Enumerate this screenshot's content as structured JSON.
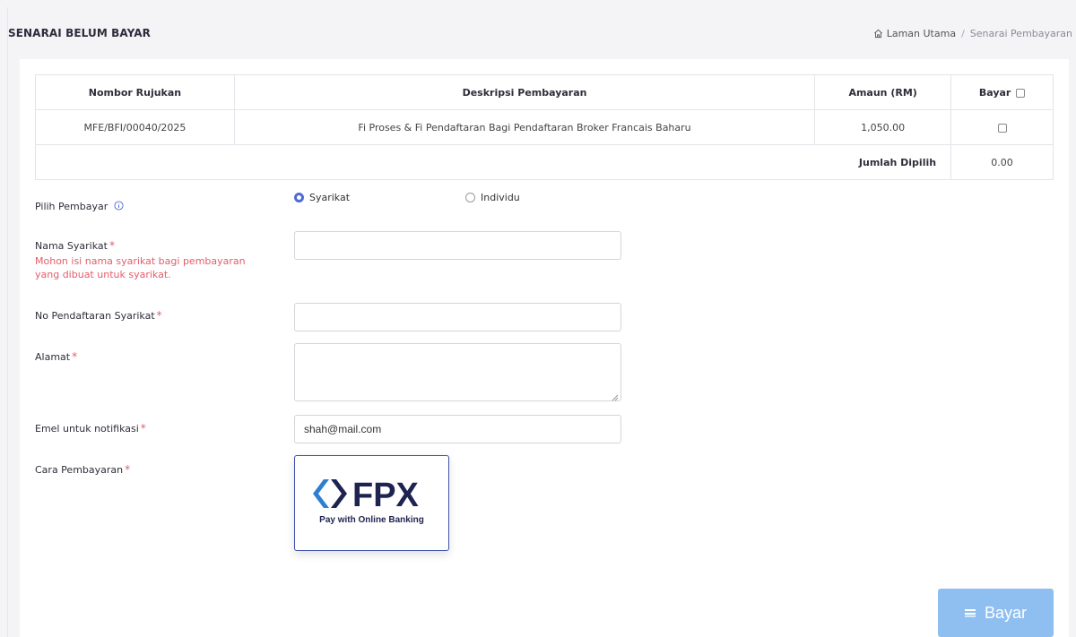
{
  "header": {
    "title": "SENARAI BELUM BAYAR",
    "breadcrumb": {
      "home": "Laman Utama",
      "separator": "/",
      "current": "Senarai Pembayaran"
    }
  },
  "table": {
    "headers": {
      "ref": "Nombor Rujukan",
      "desc": "Deskripsi Pembayaran",
      "amount": "Amaun (RM)",
      "pay": "Bayar"
    },
    "rows": [
      {
        "ref": "MFE/BFI/00040/2025",
        "desc": "Fi Proses & Fi Pendaftaran Bagi Pendaftaran Broker Francais Baharu",
        "amount": "1,050.00"
      }
    ],
    "total_label": "Jumlah Dipilih",
    "total_value": "0.00"
  },
  "form": {
    "payer_label": "Pilih Pembayar",
    "payer_options": {
      "company": "Syarikat",
      "individual": "Individu"
    },
    "payer_selected": "Syarikat",
    "company_name_label": "Nama Syarikat",
    "company_name_warning_1": "Mohon isi nama syarikat bagi pembayaran",
    "company_name_warning_2": "yang dibuat untuk syarikat.",
    "company_name_value": "",
    "reg_no_label": "No Pendaftaran Syarikat",
    "reg_no_value": "",
    "address_label": "Alamat",
    "address_value": "",
    "email_label": "Emel untuk notifikasi",
    "email_value": "shah@mail.com",
    "payment_method_label": "Cara Pembayaran",
    "required_mark": "*"
  },
  "fpx": {
    "logo_text": "FPX",
    "subtitle": "Pay with Online Banking"
  },
  "submit_button": {
    "label": "Bayar"
  },
  "colors": {
    "accent": "#4f6bd6",
    "error": "#e35d6a",
    "button": "#8fbff0",
    "fpx_navy": "#1e2350",
    "fpx_blue": "#2d7fd1"
  }
}
